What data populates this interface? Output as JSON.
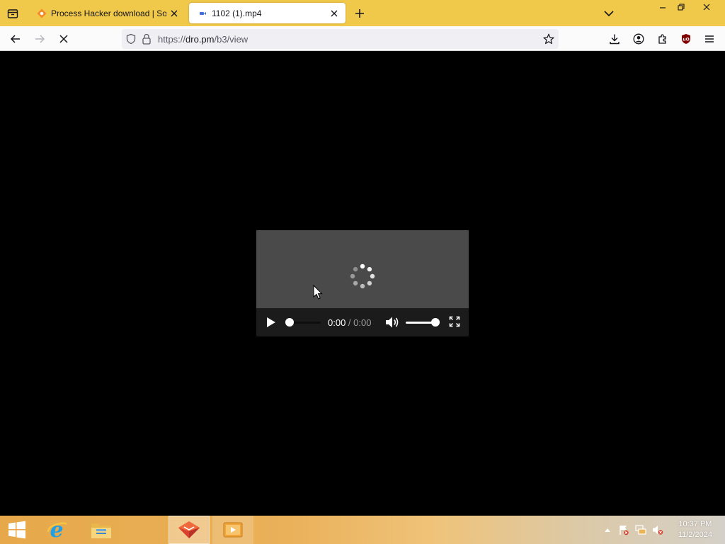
{
  "browser": {
    "tabs": [
      {
        "title": "Process Hacker download | Sou",
        "active": false,
        "favicon": "process-hacker-favicon"
      },
      {
        "title": "1102 (1).mp4",
        "active": true,
        "favicon": "video-favicon"
      }
    ],
    "url": {
      "scheme": "https://",
      "host": "dro.pm",
      "path": "/b3/view"
    },
    "colors": {
      "tabbar": "#f0c84a",
      "navbar": "#fbfbfb",
      "urlbar": "#f0f0f4"
    }
  },
  "video": {
    "current_time": "0:00",
    "separator": " / ",
    "duration": "0:00",
    "state": "loading",
    "progress": 0,
    "volume": 1
  },
  "taskbar": {
    "pinned": [
      "start-icon",
      "internet-explorer-icon",
      "file-explorer-icon",
      "firefox-icon",
      "media-player-icon"
    ],
    "clock_time": "10:37 PM",
    "clock_date": "11/2/2024"
  }
}
